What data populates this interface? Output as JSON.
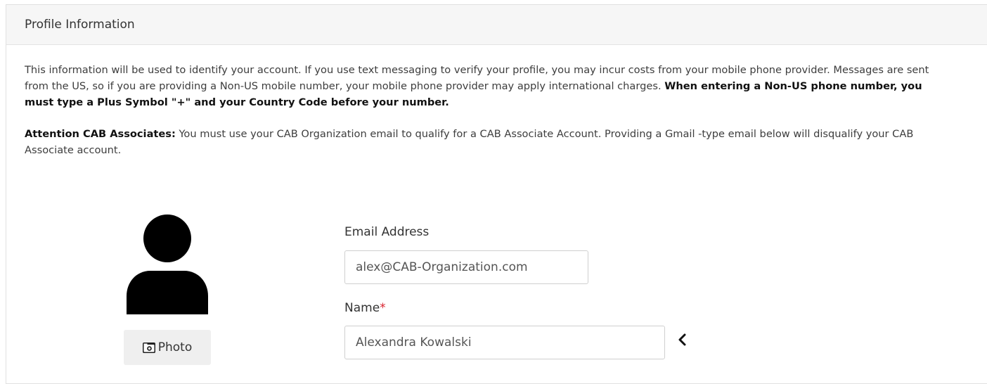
{
  "panel": {
    "title": "Profile Information"
  },
  "intro": {
    "text": "This information will be used to identify your account. If you use text messaging to verify your profile, you may incur costs from your mobile phone provider. Messages are sent from the US, so if you are providing a Non-US mobile number, your mobile phone provider may apply international charges. ",
    "bold": "When entering a Non-US phone number, you must type a Plus Symbol \"+\" and your Country Code before your number."
  },
  "attention": {
    "label": "Attention CAB Associates:",
    "text": " You must use your CAB Organization email to qualify for a CAB Associate Account.  Providing a Gmail -type email below will disqualify your CAB Associate account."
  },
  "avatar": {
    "icon": "user-silhouette-icon",
    "photo_button_label": "Photo",
    "photo_button_icon": "camera-icon"
  },
  "form": {
    "email": {
      "label": "Email Address",
      "value": "alex@CAB-Organization.com"
    },
    "name": {
      "label": "Name",
      "required_marker": "*",
      "value": "Alexandra Kowalski"
    },
    "chevron_icon": "chevron-left-icon"
  },
  "colors": {
    "heading_bg": "#f6f6f6",
    "required": "#d9232e",
    "button_bg": "#efefef"
  }
}
